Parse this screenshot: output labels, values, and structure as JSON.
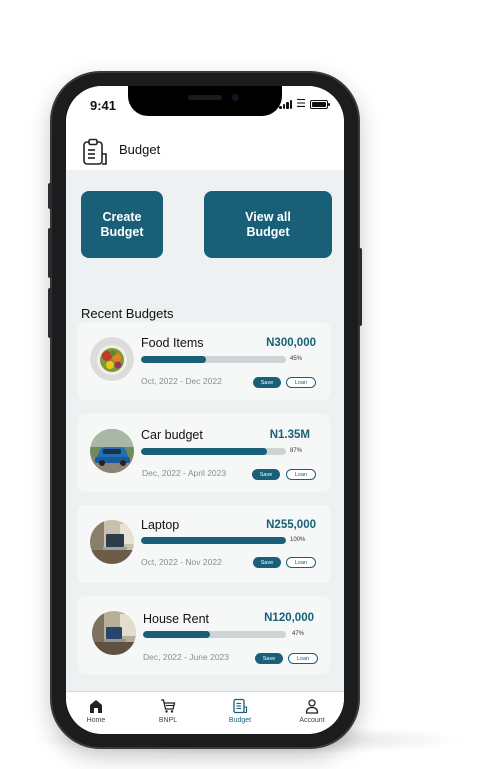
{
  "status_bar": {
    "time": "9:41"
  },
  "header": {
    "title": "Budget"
  },
  "actions": {
    "create_line1": "Create",
    "create_line2": "Budget",
    "view_line1": "View all",
    "view_line2": "Budget"
  },
  "section": {
    "title": "Recent Budgets"
  },
  "budgets": [
    {
      "name": "Food Items",
      "amount": "N300,000",
      "progress_label": "45%",
      "progress": 0.45,
      "date_range": "Oct, 2022 - Dec 2022",
      "save_label": "Save",
      "loan_label": "Loan",
      "image": "food-bowl"
    },
    {
      "name": "Car budget",
      "amount": "N1.35M",
      "progress_label": "87%",
      "progress": 0.87,
      "date_range": "Dec, 2022 - April 2023",
      "save_label": "Save",
      "loan_label": "Loan",
      "image": "blue-car"
    },
    {
      "name": "Laptop",
      "amount": "N255,000",
      "progress_label": "100%",
      "progress": 1.0,
      "date_range": "Oct, 2022 - Nov 2022",
      "save_label": "Save",
      "loan_label": "Loan",
      "image": "laptop-desk"
    },
    {
      "name": "House Rent",
      "amount": "N120,000",
      "progress_label": "47%",
      "progress": 0.47,
      "date_range": "Dec, 2022 - June 2023",
      "save_label": "Save",
      "loan_label": "Loan",
      "image": "room-interior"
    }
  ],
  "tabbar": {
    "items": [
      {
        "label": "Home",
        "icon": "home-icon"
      },
      {
        "label": "BNPL",
        "icon": "cart-icon"
      },
      {
        "label": "Budget",
        "icon": "budget-icon",
        "active": true
      },
      {
        "label": "Account",
        "icon": "user-icon"
      }
    ]
  },
  "colors": {
    "primary": "#195f78",
    "background": "#edf1f2",
    "card": "#f6f7f7",
    "track": "#d0d3d5"
  }
}
